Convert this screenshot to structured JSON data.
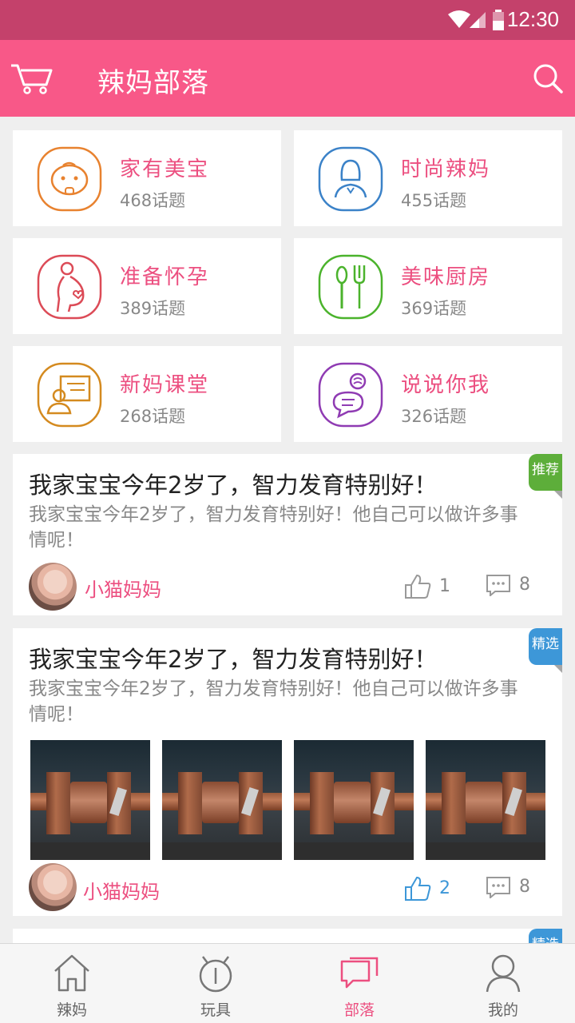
{
  "status": {
    "time": "12:30"
  },
  "header": {
    "title": "辣妈部落"
  },
  "categories": [
    {
      "name": "家有美宝",
      "count": "468话题",
      "icon": "baby-face-icon",
      "color": "#e8822f"
    },
    {
      "name": "时尚辣妈",
      "count": "455话题",
      "icon": "fashion-woman-icon",
      "color": "#3b82c8"
    },
    {
      "name": "准备怀孕",
      "count": "389话题",
      "icon": "pregnant-icon",
      "color": "#dc4b57"
    },
    {
      "name": "美味厨房",
      "count": "369话题",
      "icon": "fork-spoon-icon",
      "color": "#4bb32c"
    },
    {
      "name": "新妈课堂",
      "count": "268话题",
      "icon": "classroom-icon",
      "color": "#d48a1f"
    },
    {
      "name": "说说你我",
      "count": "326话题",
      "icon": "chat-bubbles-icon",
      "color": "#8f3bb3"
    }
  ],
  "posts": [
    {
      "tag": "推荐",
      "title": "我家宝宝今年2岁了，智力发育特别好！",
      "body": "我家宝宝今年2岁了，智力发育特别好！他自己可以做许多事情呢！",
      "author": "小猫妈妈",
      "likes": "1",
      "comments": "8"
    },
    {
      "tag": "精选",
      "title": "我家宝宝今年2岁了，智力发育特别好！",
      "body": "我家宝宝今年2岁了，智力发育特别好！他自己可以做许多事情呢！",
      "author": "小猫妈妈",
      "likes": "2",
      "comments": "8"
    },
    {
      "tag": "精选"
    }
  ],
  "nav": [
    {
      "label": "辣妈",
      "icon": "home-icon"
    },
    {
      "label": "玩具",
      "icon": "toy-icon"
    },
    {
      "label": "部落",
      "icon": "tribe-chat-icon"
    },
    {
      "label": "我的",
      "icon": "profile-icon"
    }
  ],
  "colors": {
    "accent": "#f85888",
    "statusbar": "#c4416b",
    "text_pink": "#ec4f80"
  }
}
